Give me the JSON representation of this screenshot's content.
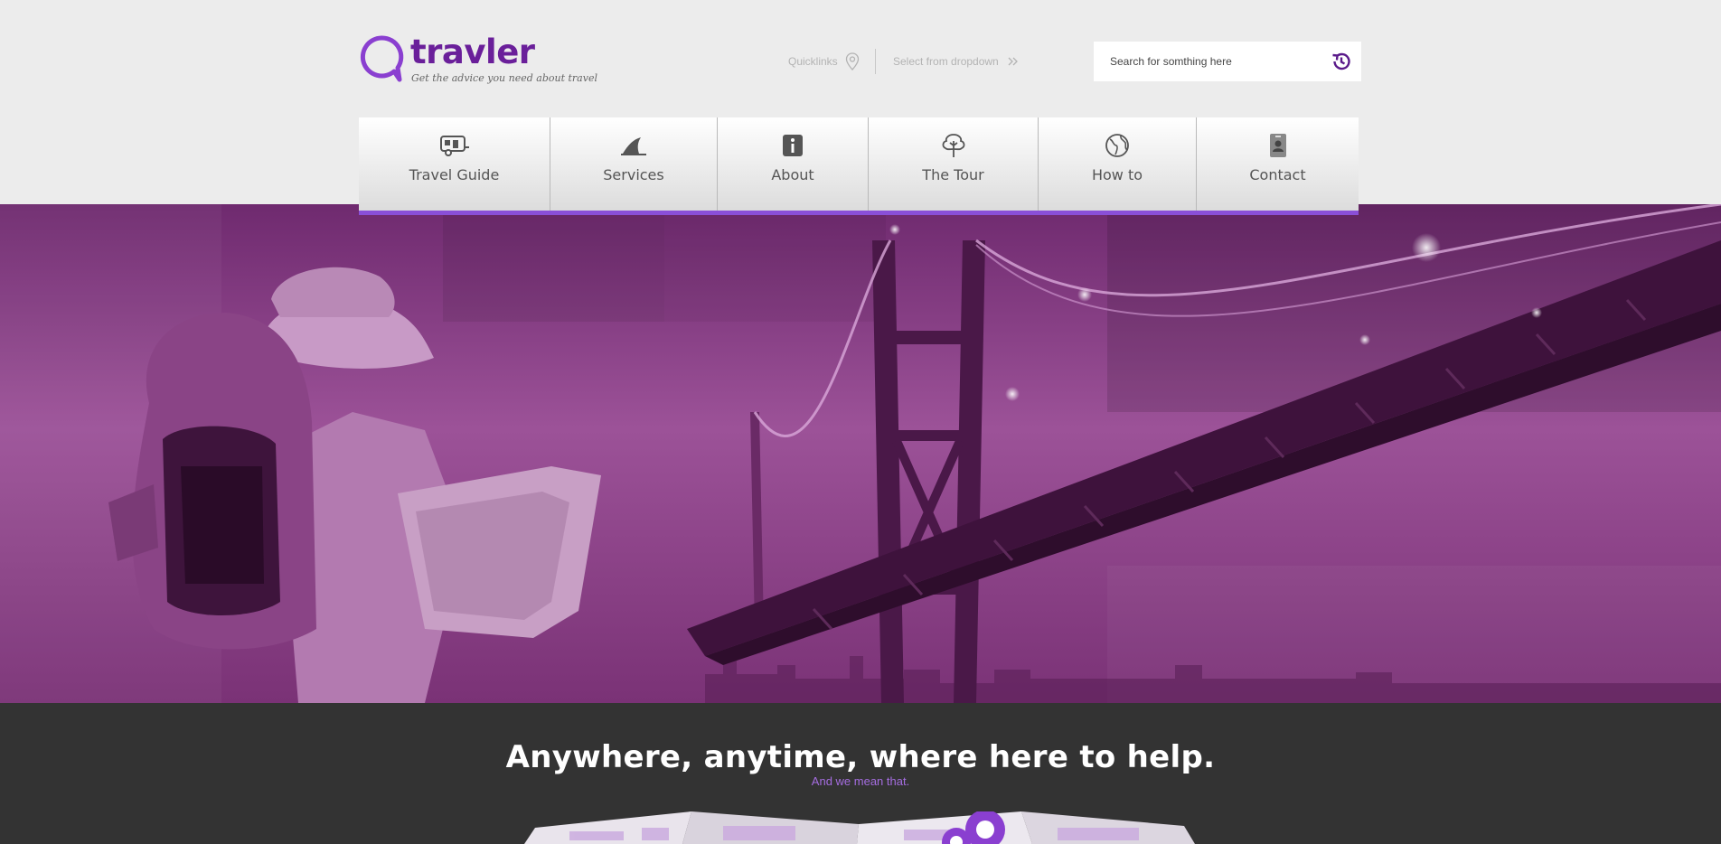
{
  "brand": {
    "name": "travler",
    "tagline": "Get the advice you need about travel",
    "accent_color": "#8a4fd8",
    "logo_color": "#6a1f9a"
  },
  "topbar": {
    "quicklinks_label": "Quicklinks",
    "quicklinks_icon": "map-pin-icon",
    "dropdown_label": "Select from dropdown",
    "dropdown_icon": "double-chevron-right-icon"
  },
  "search": {
    "placeholder": "Search for somthing here",
    "button_icon": "history-icon"
  },
  "nav": {
    "items": [
      {
        "label": "Travel Guide",
        "icon": "caravan-icon"
      },
      {
        "label": "Services",
        "icon": "shark-fin-icon"
      },
      {
        "label": "About",
        "icon": "info-icon"
      },
      {
        "label": "The Tour",
        "icon": "tree-icon"
      },
      {
        "label": "How to",
        "icon": "globe-icon"
      },
      {
        "label": "Contact",
        "icon": "contact-card-icon"
      }
    ]
  },
  "hero": {
    "image": "traveler-with-backpack-and-map-under-bridge"
  },
  "band": {
    "title": "Anywhere, anytime, where here to help.",
    "subtitle": "And we mean that.",
    "background": "#333333"
  }
}
